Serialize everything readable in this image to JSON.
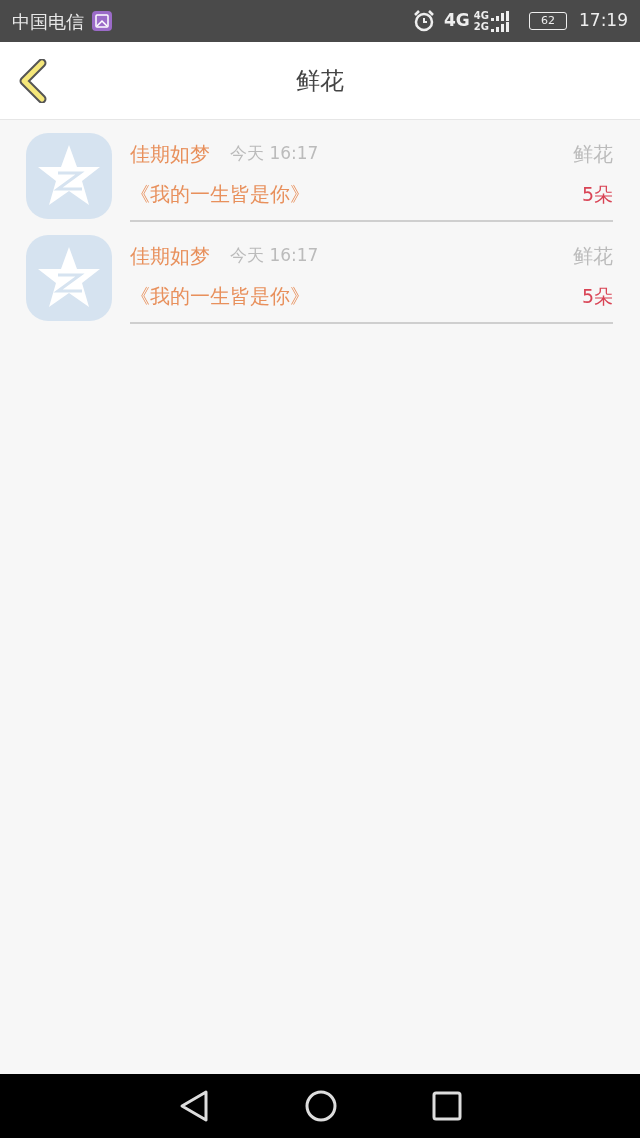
{
  "status_bar": {
    "carrier": "中国电信",
    "network": "4G",
    "signal_labels": [
      "4G",
      "2G"
    ],
    "battery": "62",
    "time": "17:19"
  },
  "header": {
    "title": "鲜花"
  },
  "items": [
    {
      "name": "佳期如梦",
      "time": "今天 16:17",
      "type": "鲜花",
      "song": "《我的一生皆是你》",
      "count": "5朵"
    },
    {
      "name": "佳期如梦",
      "time": "今天 16:17",
      "type": "鲜花",
      "song": "《我的一生皆是你》",
      "count": "5朵"
    }
  ]
}
